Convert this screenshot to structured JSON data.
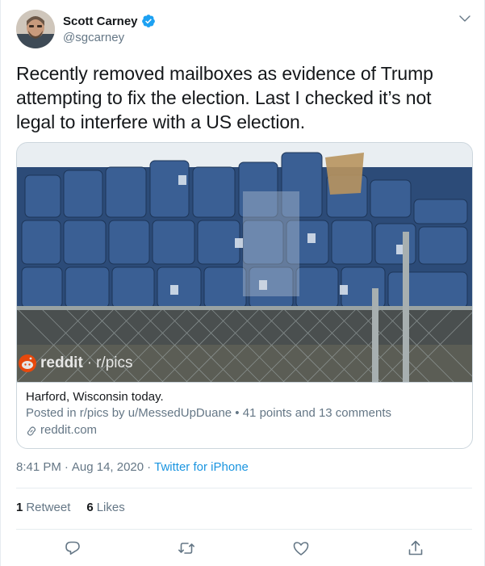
{
  "user": {
    "display_name": "Scott Carney",
    "handle": "@sgcarney",
    "verified": true
  },
  "tweet": {
    "text": "Recently removed mailboxes as evidence of Trump attempting to fix the election.  Last I checked it’s not legal to interfere with a US election."
  },
  "card": {
    "watermark_brand": "reddit",
    "watermark_sep": "·",
    "watermark_sub": "r/pics",
    "title": "Harford, Wisconsin today.",
    "description": "Posted in r/pics by u/MessedUpDuane • 41 points and 13 comments",
    "domain": "reddit.com"
  },
  "meta": {
    "time": "8:41 PM",
    "sep1": "·",
    "date": "Aug 14, 2020",
    "sep2": "·",
    "source": "Twitter for iPhone"
  },
  "stats": {
    "retweets_count": "1",
    "retweets_label": "Retweet",
    "likes_count": "6",
    "likes_label": "Likes"
  },
  "icons": {
    "reply": "reply-icon",
    "retweet": "retweet-icon",
    "like": "heart-icon",
    "share": "share-icon",
    "more": "chevron-down-icon",
    "verified": "verified-badge-icon",
    "link": "link-icon"
  },
  "colors": {
    "accent": "#1b95e0",
    "verified": "#1da1f2",
    "text": "#14171a",
    "muted": "#657786",
    "reddit": "#ff4500"
  }
}
